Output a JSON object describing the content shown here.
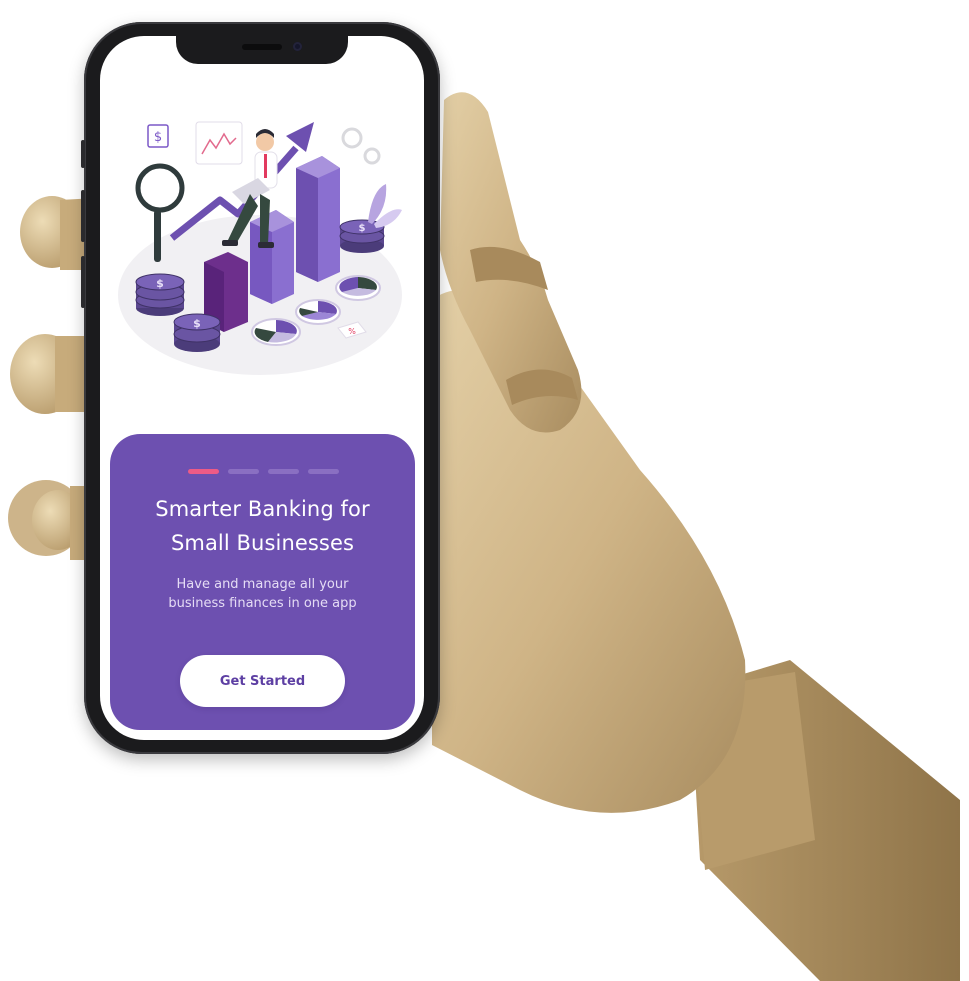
{
  "onboarding": {
    "headline_line1": "Smarter Banking for",
    "headline_line2": "Small Businesses",
    "subtext_line1": "Have and manage all your",
    "subtext_line2": "business finances in one app",
    "cta_label": "Get Started",
    "page_indicator": {
      "total_pages": 4,
      "current_page": 1
    }
  },
  "illustration": {
    "coin_symbol": "$",
    "percent_tag": "%"
  },
  "colors": {
    "card_background": "#6d50b0",
    "active_dot": "#ee5b86",
    "inactive_dot": "#8a6fc2",
    "button_background": "#ffffff",
    "button_text": "#5d3fa3",
    "accent_purple": "#7b58c7"
  },
  "icons": [
    "dollar-coin-stack-icon",
    "magnifier-icon",
    "gear-icon",
    "growth-arrow-icon",
    "pie-chart-icon",
    "bar-chart-icon",
    "leaf-icon"
  ]
}
